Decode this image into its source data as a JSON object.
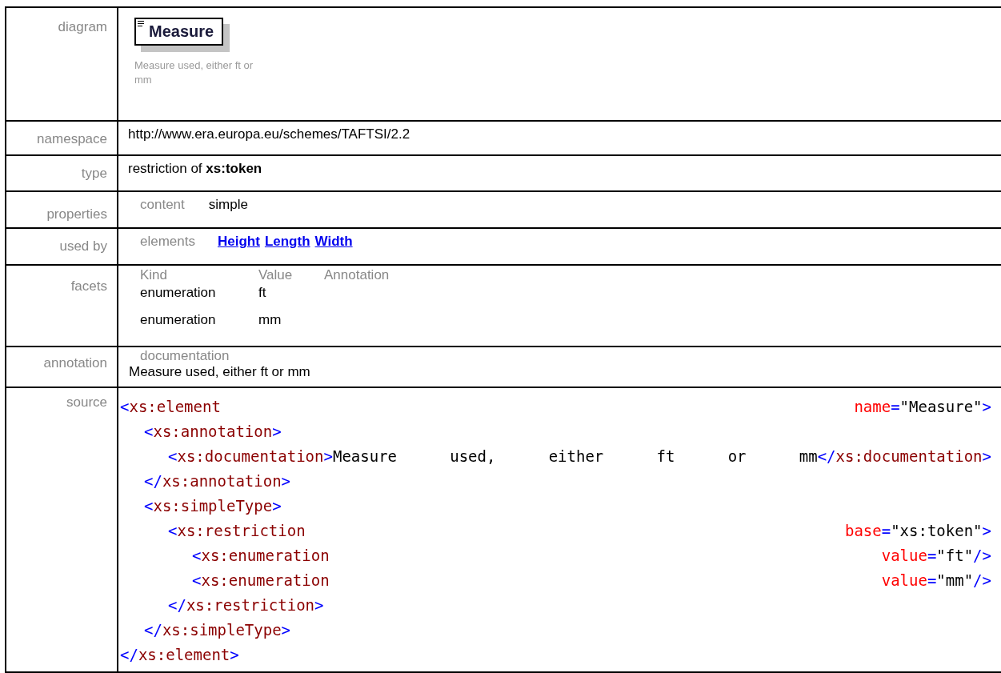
{
  "rows": [
    {
      "label": "diagram",
      "kind": "diagram",
      "element": "Measure",
      "caption": "Measure used, either ft or mm"
    },
    {
      "label": "namespace",
      "kind": "plain",
      "text": "http://www.era.europa.eu/schemes/TAFTSI/2.2"
    },
    {
      "label": "type",
      "kind": "rich",
      "text": "restriction of **xs:token**"
    },
    {
      "label": "properties",
      "kind": "props",
      "items": [
        {
          "name": "content",
          "value": "simple"
        }
      ]
    },
    {
      "label": "used by",
      "kind": "links",
      "name": "elements",
      "links": [
        "Height",
        "Length",
        "Width"
      ]
    },
    {
      "label": "facets",
      "kind": "facets",
      "columns": [
        "Kind",
        "Value",
        "Annotation"
      ],
      "rows": [
        [
          "enumeration",
          "ft"
        ],
        [
          "enumeration",
          "mm"
        ]
      ]
    },
    {
      "label": "annotation",
      "kind": "doc",
      "name": "documentation",
      "text": "Measure used, either ft or mm"
    },
    {
      "label": "source",
      "kind": "source",
      "nodes": [
        {
          "open": [
            {
              "kind": "punct",
              "text": "<"
            },
            {
              "kind": "tag",
              "text": "xs:element"
            },
            {
              "kind": "attr",
              "text": "name"
            },
            {
              "kind": "punct",
              "text": "="
            },
            {
              "kind": "value",
              "text": "\"Measure\""
            },
            {
              "kind": "punct",
              "text": ">"
            }
          ],
          "children": [
            {
              "open": [
                {
                  "kind": "punct",
                  "text": "<"
                },
                {
                  "kind": "tag",
                  "text": "xs:annotation"
                },
                {
                  "kind": "punct",
                  "text": ">"
                }
              ],
              "children": [
                {
                  "open": [
                    {
                      "kind": "punct",
                      "text": "<"
                    },
                    {
                      "kind": "tag",
                      "text": "xs:documentation"
                    },
                    {
                      "kind": "punct",
                      "text": ">"
                    },
                    {
                      "kind": "value",
                      "text": "Measure used, either ft or mm"
                    },
                    {
                      "kind": "punct",
                      "text": "</"
                    },
                    {
                      "kind": "tag",
                      "text": "xs:documentation"
                    },
                    {
                      "kind": "punct",
                      "text": ">"
                    }
                  ]
                }
              ],
              "close": [
                {
                  "kind": "punct",
                  "text": "</"
                },
                {
                  "kind": "tag",
                  "text": "xs:annotation"
                },
                {
                  "kind": "punct",
                  "text": ">"
                }
              ]
            },
            {
              "open": [
                {
                  "kind": "punct",
                  "text": "<"
                },
                {
                  "kind": "tag",
                  "text": "xs:simpleType"
                },
                {
                  "kind": "punct",
                  "text": ">"
                }
              ],
              "children": [
                {
                  "open": [
                    {
                      "kind": "punct",
                      "text": "<"
                    },
                    {
                      "kind": "tag",
                      "text": "xs:restriction"
                    },
                    {
                      "kind": "attr",
                      "text": "base"
                    },
                    {
                      "kind": "punct",
                      "text": "="
                    },
                    {
                      "kind": "value",
                      "text": "\"xs:token\""
                    },
                    {
                      "kind": "punct",
                      "text": ">"
                    }
                  ],
                  "children": [
                    {
                      "open": [
                        {
                          "kind": "punct",
                          "text": "<"
                        },
                        {
                          "kind": "tag",
                          "text": "xs:enumeration"
                        },
                        {
                          "kind": "attr",
                          "text": "value"
                        },
                        {
                          "kind": "punct",
                          "text": "="
                        },
                        {
                          "kind": "value",
                          "text": "\"ft\""
                        },
                        {
                          "kind": "punct",
                          "text": "/>"
                        }
                      ]
                    },
                    {
                      "open": [
                        {
                          "kind": "punct",
                          "text": "<"
                        },
                        {
                          "kind": "tag",
                          "text": "xs:enumeration"
                        },
                        {
                          "kind": "attr",
                          "text": "value"
                        },
                        {
                          "kind": "punct",
                          "text": "="
                        },
                        {
                          "kind": "value",
                          "text": "\"mm\""
                        },
                        {
                          "kind": "punct",
                          "text": "/>"
                        }
                      ]
                    }
                  ],
                  "close": [
                    {
                      "kind": "punct",
                      "text": "</"
                    },
                    {
                      "kind": "tag",
                      "text": "xs:restriction"
                    },
                    {
                      "kind": "punct",
                      "text": ">"
                    }
                  ]
                }
              ],
              "close": [
                {
                  "kind": "punct",
                  "text": "</"
                },
                {
                  "kind": "tag",
                  "text": "xs:simpleType"
                },
                {
                  "kind": "punct",
                  "text": ">"
                }
              ]
            }
          ],
          "close": [
            {
              "kind": "punct",
              "text": "</"
            },
            {
              "kind": "tag",
              "text": "xs:element"
            },
            {
              "kind": "punct",
              "text": ">"
            }
          ]
        }
      ]
    }
  ]
}
